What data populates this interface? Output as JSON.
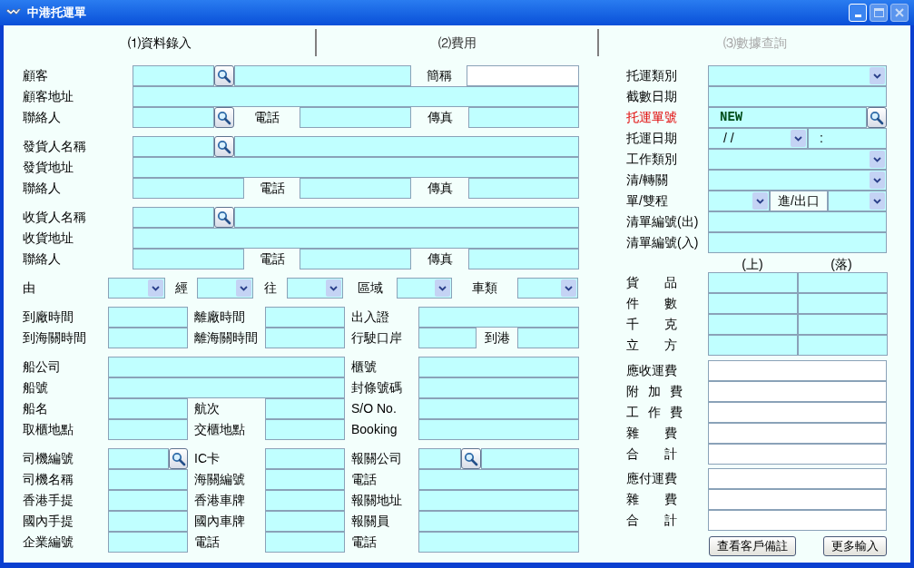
{
  "window": {
    "title": "中港托運單"
  },
  "tabs": [
    {
      "label": "⑴資料錄入",
      "selected": true,
      "disabled": false
    },
    {
      "label": "⑵費用",
      "selected": false,
      "disabled": false
    },
    {
      "label": "⑶數據查詢",
      "selected": false,
      "disabled": true
    }
  ],
  "left_groups": [
    {
      "rows": [
        {
          "cells": [
            {
              "kind": "label",
              "text": "顧客"
            },
            {
              "kind": "field"
            },
            {
              "kind": "search"
            },
            {
              "kind": "field"
            },
            {
              "kind": "label",
              "text": "簡稱"
            },
            {
              "kind": "field_white"
            }
          ]
        },
        {
          "cells": [
            {
              "kind": "label",
              "text": "顧客地址"
            },
            {
              "kind": "field"
            }
          ]
        },
        {
          "cells": [
            {
              "kind": "label",
              "text": "聯絡人"
            },
            {
              "kind": "field"
            },
            {
              "kind": "search"
            },
            {
              "kind": "label",
              "text": "電話"
            },
            {
              "kind": "field"
            },
            {
              "kind": "label",
              "text": "傳真"
            },
            {
              "kind": "field"
            }
          ]
        }
      ]
    },
    {
      "rows": [
        {
          "cells": [
            {
              "kind": "label",
              "text": "發貨人名稱"
            },
            {
              "kind": "field"
            },
            {
              "kind": "search"
            },
            {
              "kind": "field"
            }
          ]
        },
        {
          "cells": [
            {
              "kind": "label",
              "text": "發貨地址"
            },
            {
              "kind": "field"
            }
          ]
        },
        {
          "cells": [
            {
              "kind": "label",
              "text": "聯絡人"
            },
            {
              "kind": "field"
            },
            {
              "kind": "label",
              "text": "電話"
            },
            {
              "kind": "field"
            },
            {
              "kind": "label",
              "text": "傳真"
            },
            {
              "kind": "field"
            }
          ]
        }
      ]
    },
    {
      "rows": [
        {
          "cells": [
            {
              "kind": "label",
              "text": "收貨人名稱"
            },
            {
              "kind": "field"
            },
            {
              "kind": "search"
            },
            {
              "kind": "field"
            }
          ]
        },
        {
          "cells": [
            {
              "kind": "label",
              "text": "收貨地址"
            },
            {
              "kind": "field"
            }
          ]
        },
        {
          "cells": [
            {
              "kind": "label",
              "text": "聯絡人"
            },
            {
              "kind": "field"
            },
            {
              "kind": "label",
              "text": "電話"
            },
            {
              "kind": "field"
            },
            {
              "kind": "label",
              "text": "傳真"
            },
            {
              "kind": "field"
            }
          ]
        }
      ]
    },
    {
      "rows": [
        {
          "cells": [
            {
              "kind": "label",
              "text": "由"
            },
            {
              "kind": "combo"
            },
            {
              "kind": "label",
              "text": "經"
            },
            {
              "kind": "combo"
            },
            {
              "kind": "label",
              "text": "往"
            },
            {
              "kind": "combo"
            },
            {
              "kind": "label",
              "text": "區域"
            },
            {
              "kind": "combo"
            },
            {
              "kind": "label",
              "text": "車類"
            },
            {
              "kind": "combo"
            }
          ]
        }
      ]
    },
    {
      "rows": [
        {
          "cells": [
            {
              "kind": "label",
              "text": "到廠時間"
            },
            {
              "kind": "field"
            },
            {
              "kind": "label",
              "text": "離廠時間"
            },
            {
              "kind": "field"
            },
            {
              "kind": "label",
              "text": "出入證"
            },
            {
              "kind": "field"
            }
          ]
        },
        {
          "cells": [
            {
              "kind": "label",
              "text": "到海關時間"
            },
            {
              "kind": "field"
            },
            {
              "kind": "label",
              "text": "離海關時間"
            },
            {
              "kind": "field"
            },
            {
              "kind": "label",
              "text": "行駛口岸"
            },
            {
              "kind": "field"
            },
            {
              "kind": "label",
              "text": "到港"
            },
            {
              "kind": "field"
            }
          ]
        }
      ]
    },
    {
      "rows": [
        {
          "cells": [
            {
              "kind": "label",
              "text": "船公司"
            },
            {
              "kind": "field"
            },
            {
              "kind": "label",
              "text": "櫃號"
            },
            {
              "kind": "field"
            }
          ]
        },
        {
          "cells": [
            {
              "kind": "label",
              "text": "船號"
            },
            {
              "kind": "field"
            },
            {
              "kind": "label",
              "text": "封條號碼"
            },
            {
              "kind": "field"
            }
          ]
        },
        {
          "cells": [
            {
              "kind": "label",
              "text": "船名"
            },
            {
              "kind": "field"
            },
            {
              "kind": "label",
              "text": "航次"
            },
            {
              "kind": "field"
            },
            {
              "kind": "label",
              "text": "S/O No."
            },
            {
              "kind": "field"
            }
          ]
        },
        {
          "cells": [
            {
              "kind": "label",
              "text": "取櫃地點"
            },
            {
              "kind": "field"
            },
            {
              "kind": "label",
              "text": "交櫃地點"
            },
            {
              "kind": "field"
            },
            {
              "kind": "label",
              "text": "Booking"
            },
            {
              "kind": "field"
            }
          ]
        }
      ]
    },
    {
      "rows": [
        {
          "cells": [
            {
              "kind": "label",
              "text": "司機編號"
            },
            {
              "kind": "field"
            },
            {
              "kind": "search"
            },
            {
              "kind": "label",
              "text": "IC卡"
            },
            {
              "kind": "field"
            },
            {
              "kind": "label",
              "text": "報關公司"
            },
            {
              "kind": "field"
            },
            {
              "kind": "search"
            },
            {
              "kind": "field"
            }
          ]
        },
        {
          "cells": [
            {
              "kind": "label",
              "text": "司機名稱"
            },
            {
              "kind": "field"
            },
            {
              "kind": "label",
              "text": "海關編號"
            },
            {
              "kind": "field"
            },
            {
              "kind": "label",
              "text": "電話"
            },
            {
              "kind": "field"
            }
          ]
        },
        {
          "cells": [
            {
              "kind": "label",
              "text": "香港手提"
            },
            {
              "kind": "field"
            },
            {
              "kind": "label",
              "text": "香港車牌"
            },
            {
              "kind": "field"
            },
            {
              "kind": "label",
              "text": "報關地址"
            },
            {
              "kind": "field"
            }
          ]
        },
        {
          "cells": [
            {
              "kind": "label",
              "text": "國內手提"
            },
            {
              "kind": "field"
            },
            {
              "kind": "label",
              "text": "國內車牌"
            },
            {
              "kind": "field"
            },
            {
              "kind": "label",
              "text": "報關員"
            },
            {
              "kind": "field"
            }
          ]
        },
        {
          "cells": [
            {
              "kind": "label",
              "text": "企業編號"
            },
            {
              "kind": "field"
            },
            {
              "kind": "label",
              "text": "電話"
            },
            {
              "kind": "field"
            },
            {
              "kind": "label",
              "text": "電話"
            },
            {
              "kind": "field"
            }
          ]
        }
      ]
    }
  ],
  "right_rows": [
    {
      "cells": [
        {
          "kind": "label",
          "text": "托運類別"
        },
        {
          "kind": "combo"
        }
      ]
    },
    {
      "cells": [
        {
          "kind": "label",
          "text": "截數日期"
        },
        {
          "kind": "field"
        }
      ]
    },
    {
      "cells": [
        {
          "kind": "required_label",
          "text": "托運單號"
        },
        {
          "kind": "code_field",
          "value": "NEW"
        },
        {
          "kind": "search"
        }
      ]
    },
    {
      "cells": [
        {
          "kind": "label",
          "text": "托運日期"
        },
        {
          "kind": "combo",
          "value": "/ /"
        },
        {
          "kind": "field",
          "value": ":"
        }
      ]
    },
    {
      "cells": [
        {
          "kind": "label",
          "text": "工作類別"
        },
        {
          "kind": "combo"
        }
      ]
    },
    {
      "cells": [
        {
          "kind": "label",
          "text": "清/轉關"
        },
        {
          "kind": "combo"
        }
      ]
    },
    {
      "cells": [
        {
          "kind": "label",
          "text": "單/雙程"
        },
        {
          "kind": "combo"
        },
        {
          "kind": "boxed_label",
          "text": "進/出口"
        },
        {
          "kind": "combo"
        }
      ]
    },
    {
      "cells": [
        {
          "kind": "label",
          "text": "清單編號(出)"
        },
        {
          "kind": "field"
        }
      ]
    },
    {
      "cells": [
        {
          "kind": "label",
          "text": "清單編號(入)"
        },
        {
          "kind": "field"
        }
      ]
    }
  ],
  "measure_grid": {
    "columns": [
      "(上)",
      "(落)"
    ],
    "rows": [
      {
        "label": "貨　　品"
      },
      {
        "label": "件　　數"
      },
      {
        "label": "千　　克"
      },
      {
        "label": "立　　方"
      }
    ]
  },
  "charges": [
    {
      "rows": [
        {
          "label": "應收運費"
        },
        {
          "label": "附 加 費"
        },
        {
          "label": "工 作 費"
        },
        {
          "label": "雜　　費"
        },
        {
          "label": "合　　計"
        }
      ]
    },
    {
      "rows": [
        {
          "label": "應付運費"
        },
        {
          "label": "雜　　費"
        },
        {
          "label": "合　　計"
        }
      ]
    }
  ],
  "buttons": [
    {
      "label": "查看客戶備註"
    },
    {
      "label": "更多輸入"
    }
  ]
}
